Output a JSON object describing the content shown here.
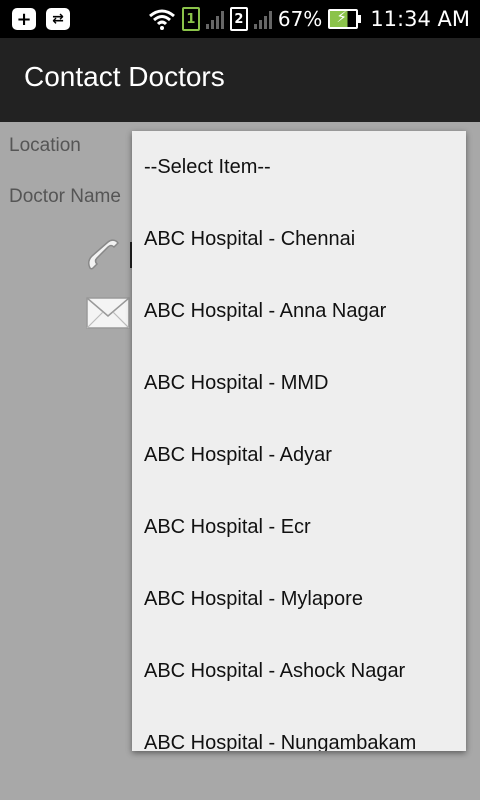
{
  "status_bar": {
    "battery_percent": "67%",
    "time": "11:34 AM",
    "sim1": "1",
    "sim2": "2",
    "icons": [
      "plus-icon",
      "usb-icon",
      "wifi-icon",
      "sim1-icon",
      "signal-icon",
      "sim2-icon",
      "signal-icon",
      "battery-charging-icon"
    ]
  },
  "action_bar": {
    "title": "Contact Doctors"
  },
  "form": {
    "location_label": "Location",
    "doctor_name_label": "Doctor Name"
  },
  "dropdown": {
    "items": [
      "--Select Item--",
      "ABC Hospital - Chennai",
      "ABC Hospital - Anna Nagar",
      "ABC Hospital - MMD",
      "ABC Hospital - Adyar",
      "ABC Hospital - Ecr",
      "ABC Hospital - Mylapore",
      "ABC Hospital - Ashock Nagar",
      "ABC Hospital - Nungambakam"
    ]
  }
}
